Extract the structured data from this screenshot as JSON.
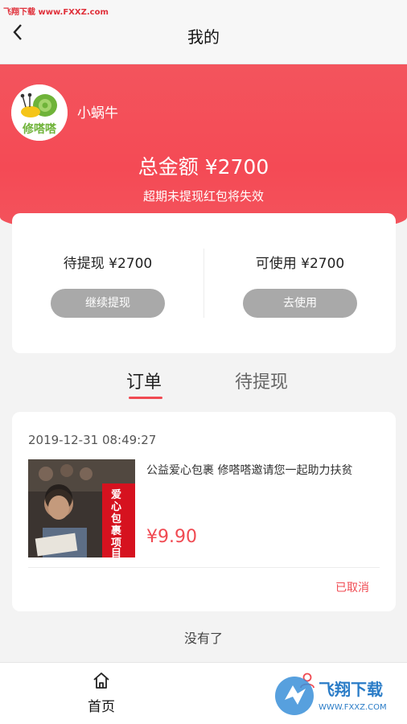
{
  "watermark": {
    "top_left": "飞翔下载 www.FXXZ.com",
    "brand": "飞翔下载",
    "url": "WWW.FXXZ.COM"
  },
  "nav": {
    "back_icon": "chevron-left-icon",
    "title": "我的"
  },
  "profile": {
    "avatar_text": "修嗒嗒",
    "username": "小蜗牛"
  },
  "summary": {
    "total": "总金额 ¥2700",
    "notice": "超期未提现红包将失效"
  },
  "wallet": {
    "left": {
      "label": "待提现 ¥2700",
      "button": "继续提现"
    },
    "right": {
      "label": "可使用 ¥2700",
      "button": "去使用"
    }
  },
  "tabs": [
    {
      "label": "订单",
      "active": true
    },
    {
      "label": "待提现",
      "active": false
    }
  ],
  "order": {
    "time": "2019-12-31 08:49:27",
    "thumb_text": "爱心包裹项目",
    "description": "公益爱心包裹 修嗒嗒邀请您一起助力扶贫",
    "price": "¥9.90",
    "status": "已取消"
  },
  "end_text": "没有了",
  "bottom_nav": {
    "home": {
      "label": "首页",
      "icon": "home-icon"
    },
    "mine": {
      "icon": "user-icon"
    }
  },
  "colors": {
    "accent": "#f04a52",
    "hero": "#f44a55",
    "button_gray": "#a9a9a9"
  }
}
